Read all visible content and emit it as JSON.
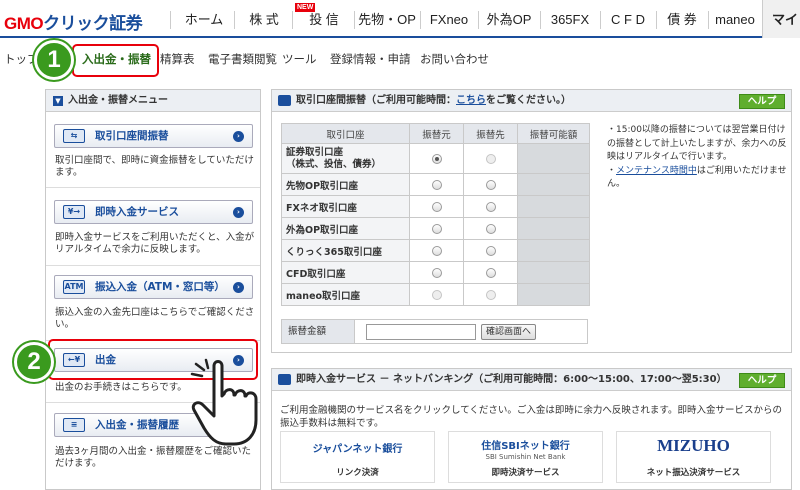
{
  "brand": {
    "name_gmo": "GMO",
    "name_rest": "クリック証券"
  },
  "topnav": {
    "items": [
      "ホーム",
      "株 式",
      "投 信",
      "先物・OP",
      "FXneo",
      "外為OP",
      "365FX",
      "C F D",
      "債 券",
      "maneo",
      "マイ"
    ],
    "new_badge": "NEW"
  },
  "subnav": {
    "items": [
      "トップ",
      "入出金・振替",
      "精算表",
      "電子書類閲覧",
      "ツール",
      "登録情報・申請",
      "お問い合わせ"
    ]
  },
  "steps": {
    "one": "1",
    "two": "2"
  },
  "sidebar": {
    "title": "入出金・振替メニュー",
    "items": [
      {
        "label": "取引口座間振替",
        "desc": "取引口座間で、即時に資金振替をしていただけます。",
        "icon": "transfer-icon"
      },
      {
        "label": "即時入金サービス",
        "desc": "即時入金サービスをご利用いただくと、入金がリアルタイムで余力に反映します。",
        "icon": "instant-deposit-icon"
      },
      {
        "label": "振込入金（ATM・窓口等）",
        "desc": "振込入金の入金先口座はこちらでご確認ください。",
        "icon": "atm-icon"
      },
      {
        "label": "出金",
        "desc": "出金のお手続きはこちらです。",
        "icon": "withdraw-icon"
      },
      {
        "label": "入出金・振替履歴",
        "desc": "過去3ヶ月間の入出金・振替履歴をご確認いただけます。",
        "icon": "history-icon"
      }
    ]
  },
  "transfer": {
    "title_prefix": "取引口座間振替（ご利用可能時間：",
    "title_link": "こちら",
    "title_suffix": "をご覧ください。）",
    "help": "ヘルプ",
    "headers": [
      "取引口座",
      "振替元",
      "振替先",
      "振替可能額"
    ],
    "rows": [
      {
        "account": "証券取引口座\n（株式、投信、債券）",
        "from": "selected",
        "to": "disabled"
      },
      {
        "account": "先物OP取引口座",
        "from": "empty",
        "to": "empty"
      },
      {
        "account": "FXネオ取引口座",
        "from": "empty",
        "to": "empty"
      },
      {
        "account": "外為OP取引口座",
        "from": "empty",
        "to": "empty"
      },
      {
        "account": "くりっく365取引口座",
        "from": "empty",
        "to": "empty"
      },
      {
        "account": "CFD取引口座",
        "from": "empty",
        "to": "empty"
      },
      {
        "account": "maneo取引口座",
        "from": "disabled",
        "to": "disabled"
      }
    ],
    "amount_label": "振替金額",
    "amount_value": "",
    "confirm": "確認画面へ",
    "notes": [
      "・15:00以降の振替については翌営業日付けの振替として計上いたしますが、余力への反映はリアルタイムで行います。",
      "・メンテナンス時間中はご利用いただけません。"
    ],
    "notes_link": "メンテナンス時間中"
  },
  "instant": {
    "title": "即時入金サービス － ネットバンキング（ご利用可能時間：6:00～15:00、17:00～翌5:30）",
    "help": "ヘルプ",
    "desc": "ご利用金融機関のサービス名をクリックしてください。ご入金は即時に余力へ反映されます。即時入金サービスからの振込手数料は無料です。",
    "banks": [
      {
        "name": "ジャパンネット銀行",
        "service": "リンク決済",
        "color": "#1a4e9c"
      },
      {
        "name": "住信SBIネット銀行",
        "sub": "SBI Sumishin Net Bank",
        "service": "即時決済サービス",
        "color": "#1a4e9c"
      },
      {
        "name": "MIZUHO",
        "service": "ネット振込決済サービス",
        "color": "#1a3f8c"
      }
    ]
  },
  "colors": {
    "brand_blue": "#1a4e9c",
    "brand_red": "#e8000b",
    "step_green": "#3a9a1e",
    "help_green": "#5fae2e"
  }
}
